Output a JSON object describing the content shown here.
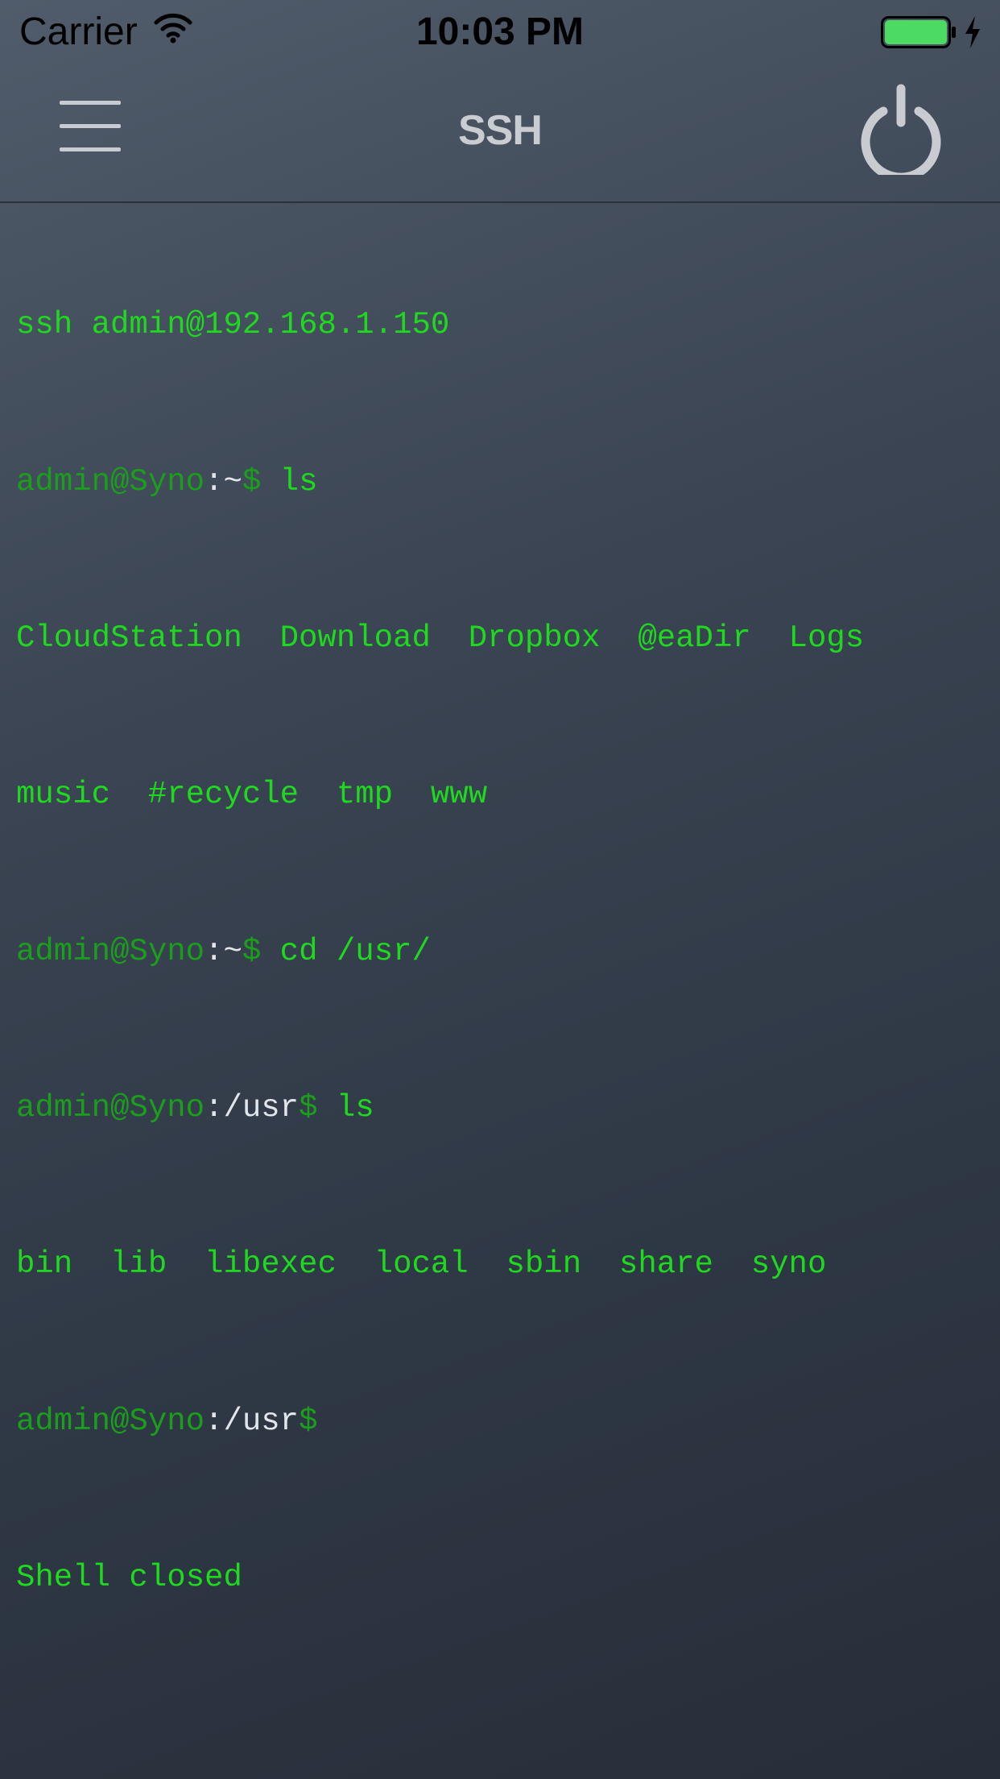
{
  "status_bar": {
    "carrier": "Carrier",
    "time": "10:03 PM",
    "battery_color": "#4cd964"
  },
  "nav": {
    "title": "SSH",
    "menu_icon": "hamburger-menu-icon",
    "power_icon": "power-icon"
  },
  "terminal": {
    "text_color": "#1fd91f",
    "lines": {
      "l1": {
        "cmd": "ssh admin@192.168.1.150"
      },
      "l2": {
        "user_host": "admin@Syno",
        "sep": ":",
        "path": "~",
        "dollar": "$",
        "cmd": " ls"
      },
      "l3": {
        "out": "CloudStation  Download  Dropbox  @eaDir  Logs"
      },
      "l4": {
        "out": "music  #recycle  tmp  www"
      },
      "l5": {
        "user_host": "admin@Syno",
        "sep": ":",
        "path": "~",
        "dollar": "$",
        "cmd": " cd /usr/"
      },
      "l6": {
        "user_host": "admin@Syno",
        "sep": ":",
        "path": "/usr",
        "dollar": "$",
        "cmd": " ls"
      },
      "l7": {
        "out": "bin  lib  libexec  local  sbin  share  syno"
      },
      "l8": {
        "user_host": "admin@Syno",
        "sep": ":",
        "path": "/usr",
        "dollar": "$"
      },
      "l9": {
        "out": "Shell closed"
      }
    }
  }
}
